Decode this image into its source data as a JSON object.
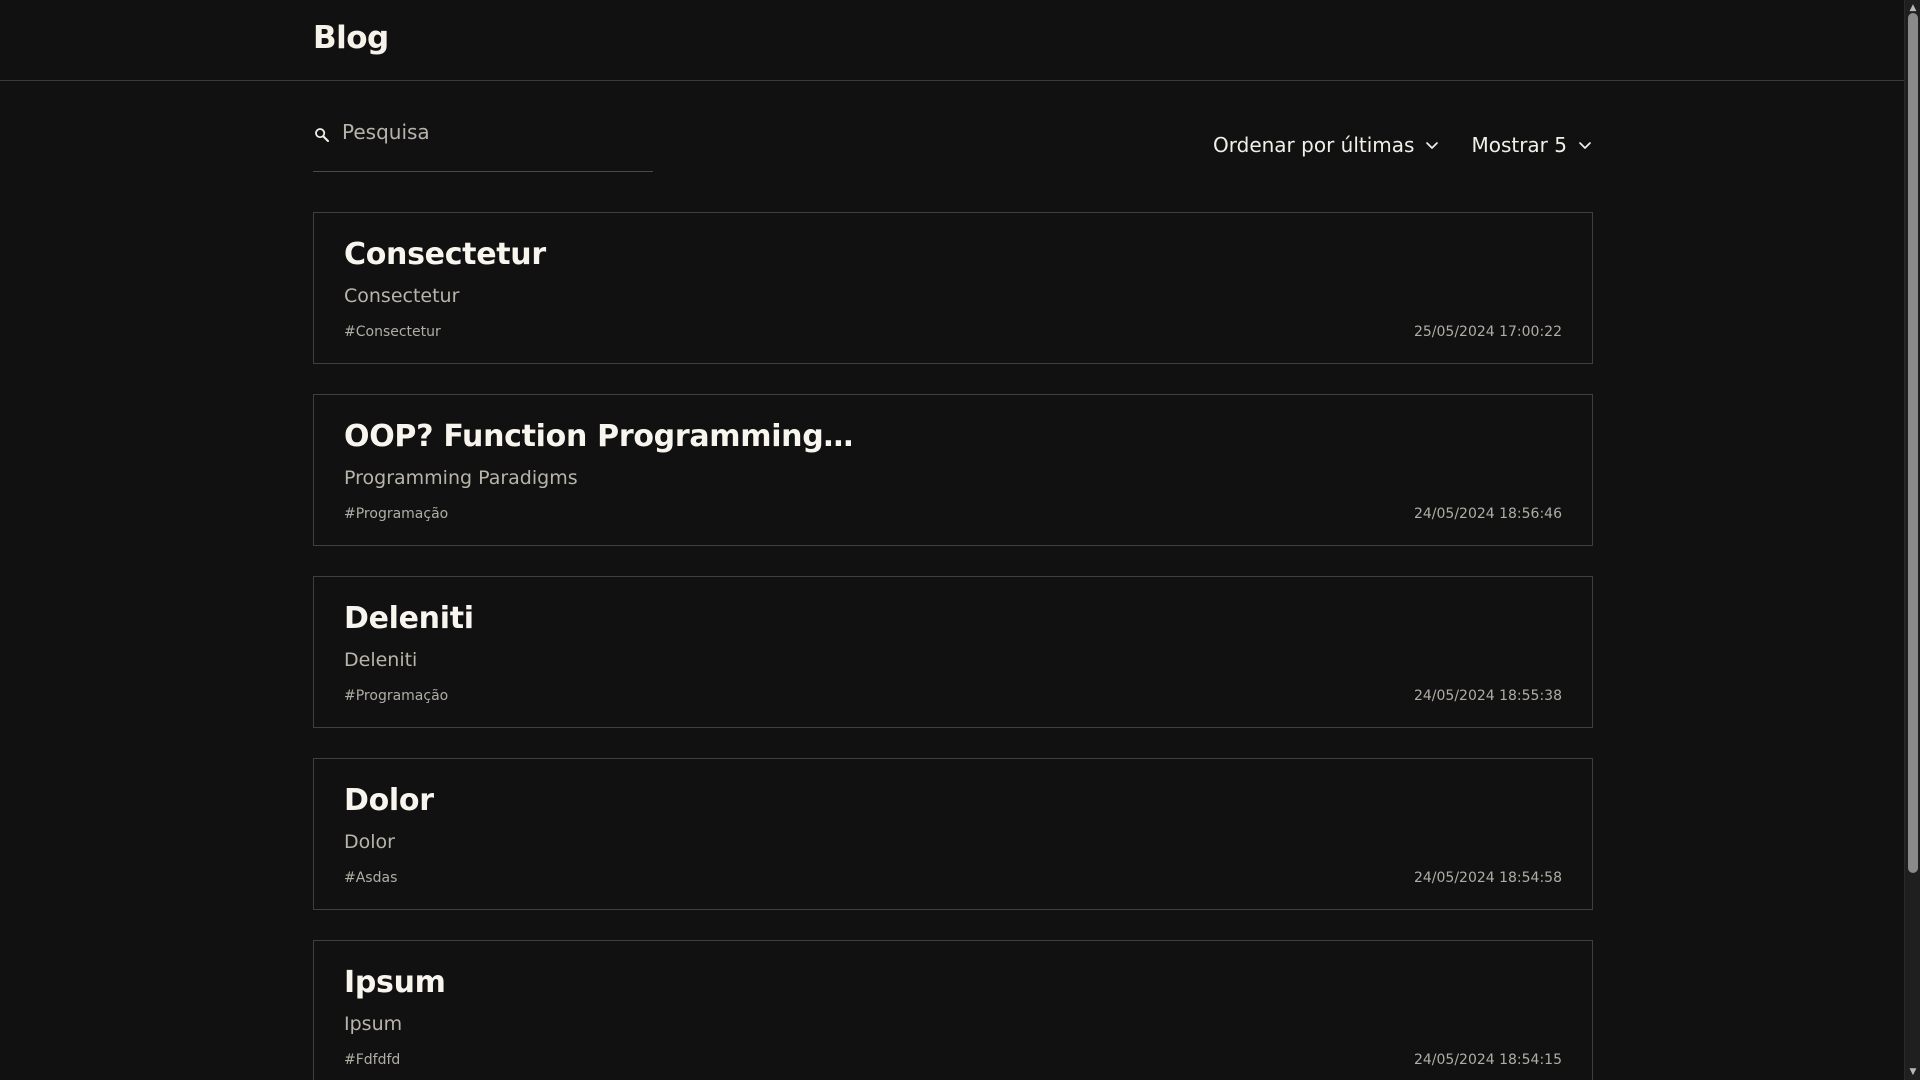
{
  "brand": "Blog",
  "search": {
    "placeholder": "Pesquisa",
    "value": ""
  },
  "controls": {
    "sort_label": "Ordenar por últimas",
    "show_label": "Mostrar 5"
  },
  "posts": [
    {
      "title": "Consectetur",
      "subtitle": "Consectetur",
      "tag": "#Consectetur",
      "date": "25/05/2024 17:00:22"
    },
    {
      "title": "OOP? Function Programming?De...",
      "subtitle": "Programming Paradigms",
      "tag": "#Programação",
      "date": "24/05/2024 18:56:46"
    },
    {
      "title": "Deleniti",
      "subtitle": "Deleniti",
      "tag": "#Programação",
      "date": "24/05/2024 18:55:38"
    },
    {
      "title": "Dolor",
      "subtitle": "Dolor",
      "tag": "#Asdas",
      "date": "24/05/2024 18:54:58"
    },
    {
      "title": "Ipsum",
      "subtitle": "Ipsum",
      "tag": "#Fdfdfd",
      "date": "24/05/2024 18:54:15"
    }
  ],
  "icons": {
    "search": "search-icon",
    "chevron": "chevron-down-icon"
  },
  "colors": {
    "background": "#111111",
    "text": "#f1efe8",
    "muted": "#b0ada5",
    "border": "#3f3f3f"
  }
}
